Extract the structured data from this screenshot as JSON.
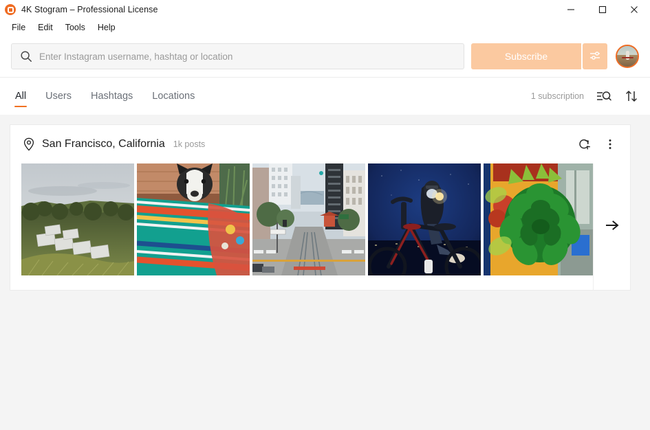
{
  "window": {
    "title": "4K Stogram – Professional License",
    "app_icon": "camera-lens-icon",
    "accent_color": "#ef6c23",
    "controls": {
      "minimize": "minimize-icon",
      "maximize": "maximize-icon",
      "close": "close-icon"
    }
  },
  "menubar": {
    "items": [
      {
        "label": "File"
      },
      {
        "label": "Edit"
      },
      {
        "label": "Tools"
      },
      {
        "label": "Help"
      }
    ]
  },
  "search": {
    "icon": "search-icon",
    "placeholder": "Enter Instagram username, hashtag or location",
    "value": "",
    "subscribe_label": "Subscribe",
    "subscribe_color": "#fbc9a0",
    "settings_icon": "sliders-icon",
    "avatar": "user-avatar"
  },
  "tabs": {
    "items": [
      {
        "label": "All",
        "active": true
      },
      {
        "label": "Users",
        "active": false
      },
      {
        "label": "Hashtags",
        "active": false
      },
      {
        "label": "Locations",
        "active": false
      }
    ],
    "active_indicator_color": "#f07021",
    "subscription_count": "1 subscription",
    "filter_icon": "filter-search-icon",
    "sort_icon": "sort-arrows-icon"
  },
  "subscription_card": {
    "type_icon": "location-pin-icon",
    "title": "San Francisco, California",
    "posts": "1k posts",
    "refresh_icon": "refresh-icon",
    "more_icon": "more-vertical-icon",
    "next_icon": "arrow-right-icon",
    "thumbnails": [
      {
        "alt": "aerial view of hillside houses and trees"
      },
      {
        "alt": "dog wrapped in striped blanket"
      },
      {
        "alt": "san francisco street with cable car tracks"
      },
      {
        "alt": "cyclist at night in blue light"
      },
      {
        "alt": "green succulent plant"
      }
    ]
  }
}
